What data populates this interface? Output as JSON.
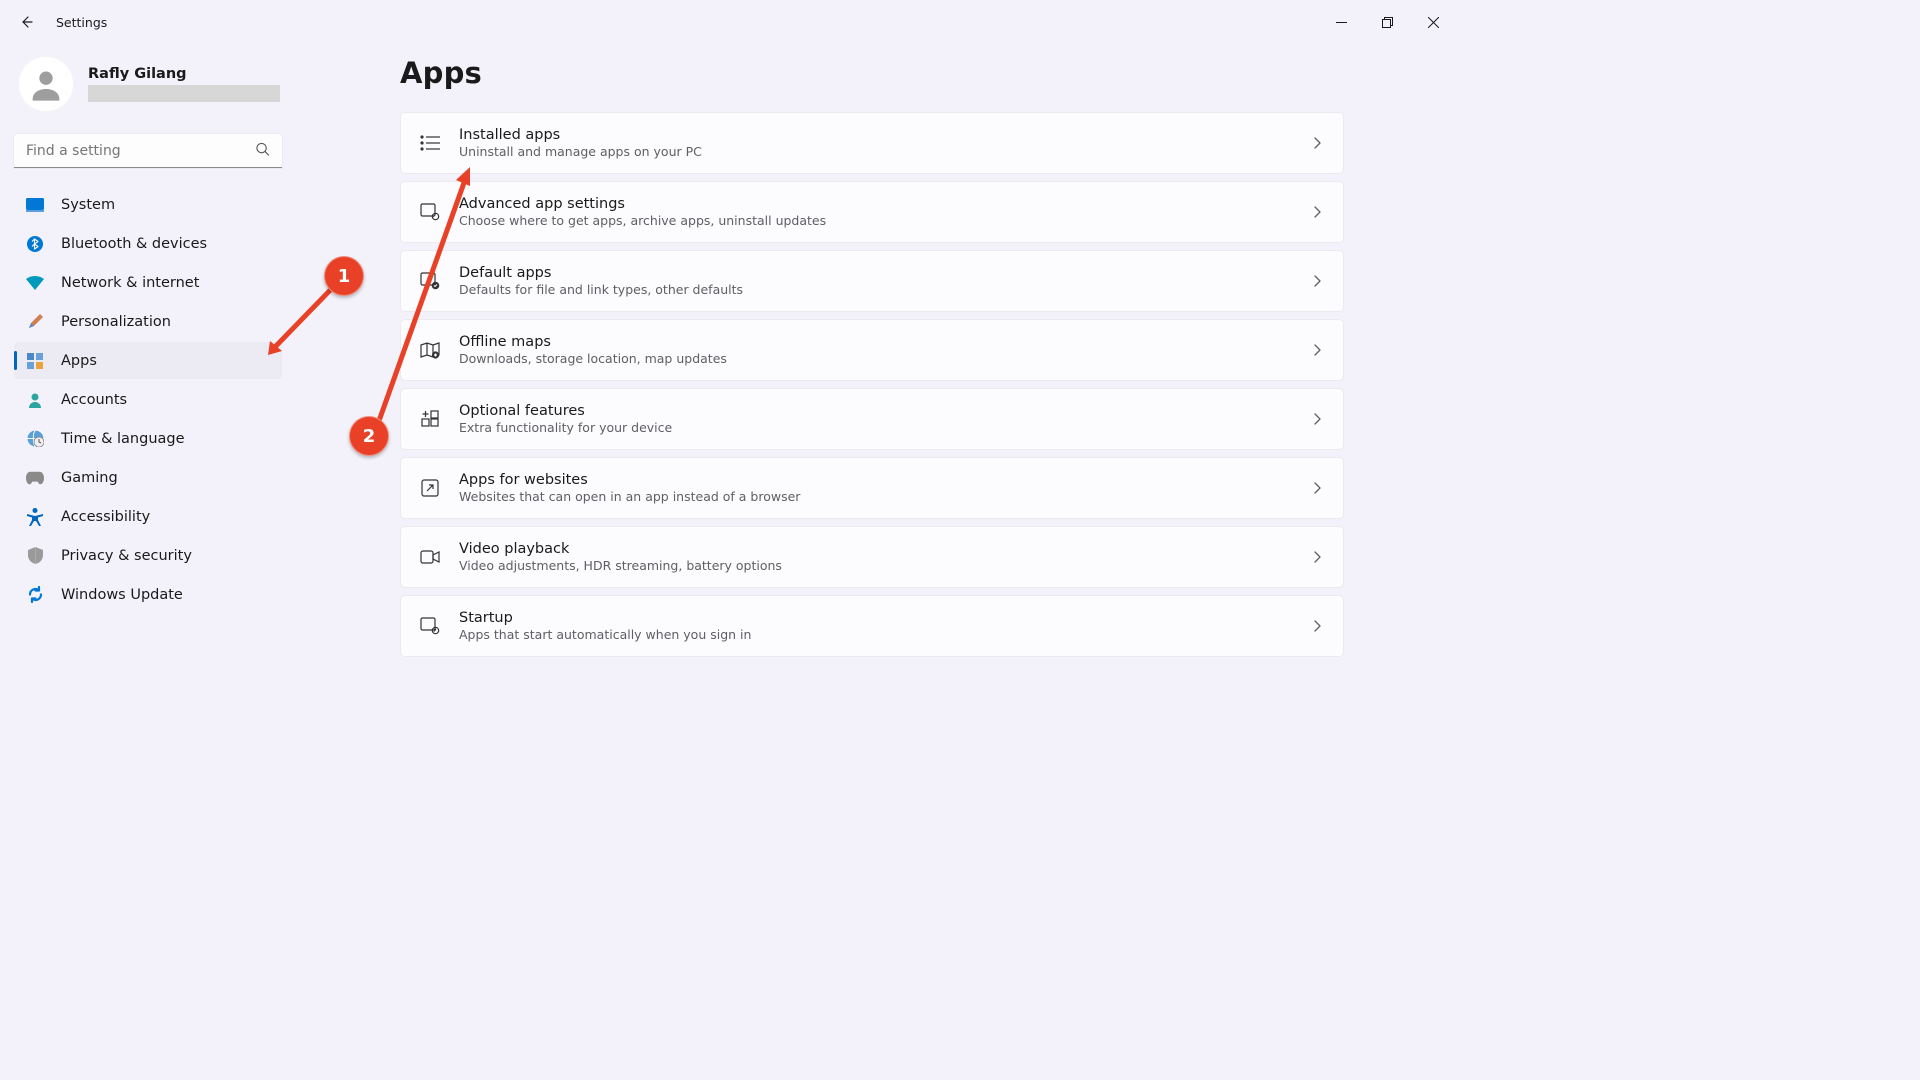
{
  "window": {
    "title": "Settings",
    "back_label": "Back"
  },
  "profile": {
    "name": "Rafly Gilang"
  },
  "search": {
    "placeholder": "Find a setting"
  },
  "sidebar": {
    "items": [
      {
        "id": "system",
        "label": "System"
      },
      {
        "id": "bluetooth",
        "label": "Bluetooth & devices"
      },
      {
        "id": "network",
        "label": "Network & internet"
      },
      {
        "id": "personalization",
        "label": "Personalization"
      },
      {
        "id": "apps",
        "label": "Apps"
      },
      {
        "id": "accounts",
        "label": "Accounts"
      },
      {
        "id": "time",
        "label": "Time & language"
      },
      {
        "id": "gaming",
        "label": "Gaming"
      },
      {
        "id": "accessibility",
        "label": "Accessibility"
      },
      {
        "id": "privacy",
        "label": "Privacy & security"
      },
      {
        "id": "update",
        "label": "Windows Update"
      }
    ],
    "active_index": 4
  },
  "page": {
    "title": "Apps",
    "cards": [
      {
        "id": "installed-apps",
        "title": "Installed apps",
        "sub": "Uninstall and manage apps on your PC"
      },
      {
        "id": "advanced-app",
        "title": "Advanced app settings",
        "sub": "Choose where to get apps, archive apps, uninstall updates"
      },
      {
        "id": "default-apps",
        "title": "Default apps",
        "sub": "Defaults for file and link types, other defaults"
      },
      {
        "id": "offline-maps",
        "title": "Offline maps",
        "sub": "Downloads, storage location, map updates"
      },
      {
        "id": "optional-features",
        "title": "Optional features",
        "sub": "Extra functionality for your device"
      },
      {
        "id": "apps-for-websites",
        "title": "Apps for websites",
        "sub": "Websites that can open in an app instead of a browser"
      },
      {
        "id": "video-playback",
        "title": "Video playback",
        "sub": "Video adjustments, HDR streaming, battery options"
      },
      {
        "id": "startup",
        "title": "Startup",
        "sub": "Apps that start automatically when you sign in"
      }
    ]
  },
  "annotations": {
    "step1": "1",
    "step2": "2"
  },
  "colors": {
    "accent": "#0067c0",
    "annotation": "#e84127",
    "bg": "#f3f2fa",
    "card": "#fcfbfd"
  }
}
